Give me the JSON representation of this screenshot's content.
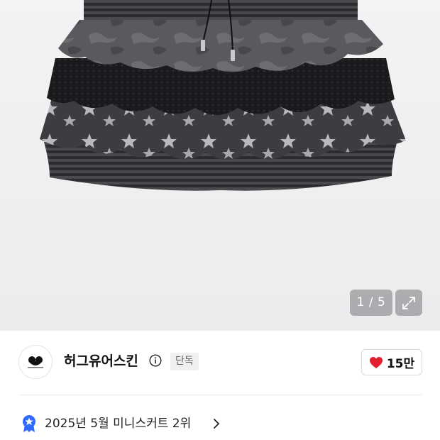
{
  "gallery": {
    "counter": "1 / 5",
    "expand_icon": "expand-icon"
  },
  "brand": {
    "name": "허그유어스킨",
    "badge": "단독",
    "info_icon": "info-icon",
    "like_count": "15만",
    "like_icon": "heart-icon",
    "like_color": "#e5202e"
  },
  "ranking": {
    "text": "2025년 5월 미니스커트 2위",
    "icon": "ranking-badge-icon",
    "icon_color": "#2f6bff"
  }
}
